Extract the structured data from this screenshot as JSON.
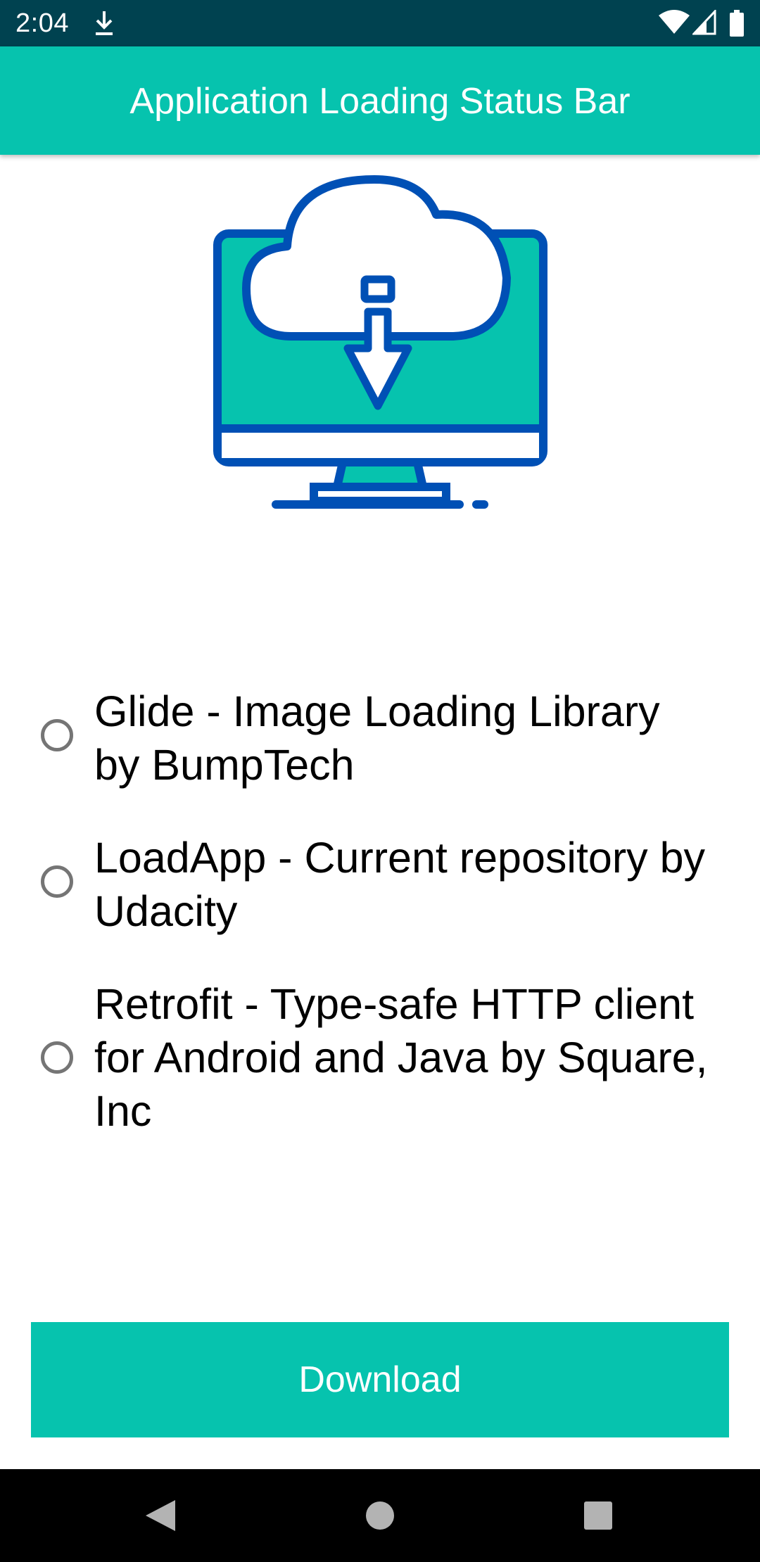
{
  "status_bar": {
    "time": "2:04",
    "icons": [
      "download-icon",
      "wifi-icon",
      "signal-icon",
      "battery-icon"
    ],
    "background": "#004250"
  },
  "app_bar": {
    "title": "Application Loading Status Bar",
    "color": "#06C3AE"
  },
  "illustration": {
    "icon": "cloud-download-monitor-icon",
    "colors": {
      "outline": "#0050B5",
      "screen": "#06C3AE"
    }
  },
  "options": [
    {
      "label": "Glide - Image Loading Library by BumpTech",
      "selected": false
    },
    {
      "label": "LoadApp - Current repository by Udacity",
      "selected": false
    },
    {
      "label": "Retrofit - Type-safe HTTP client for Android and Java by Square, Inc",
      "selected": false
    }
  ],
  "download_button": {
    "label": "Download",
    "color": "#06C3AE"
  },
  "nav_bar": {
    "buttons": [
      "back-icon",
      "home-icon",
      "recents-icon"
    ]
  }
}
